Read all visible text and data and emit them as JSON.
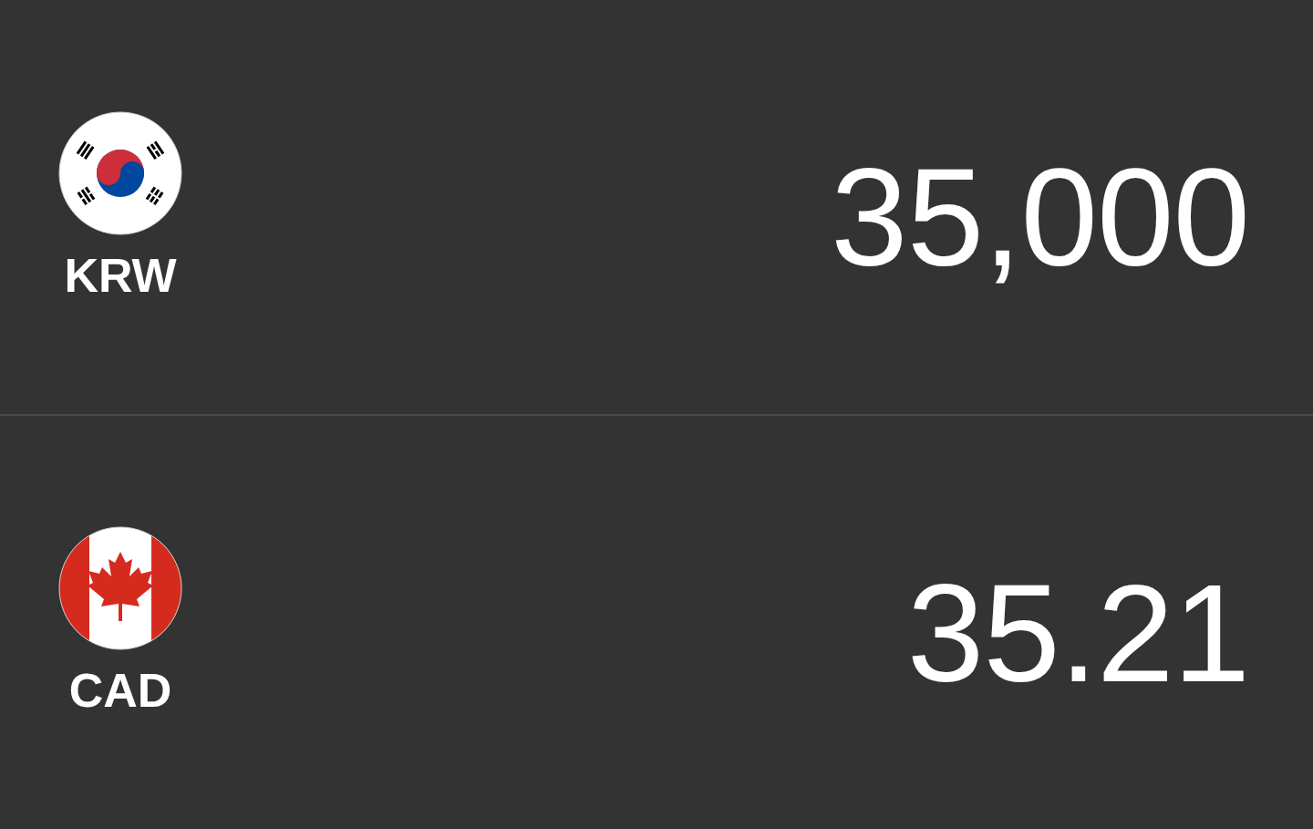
{
  "currencies": [
    {
      "code": "KRW",
      "kind": "kr",
      "amount": "35,000"
    },
    {
      "code": "CAD",
      "kind": "ca",
      "amount": "35.21"
    }
  ]
}
